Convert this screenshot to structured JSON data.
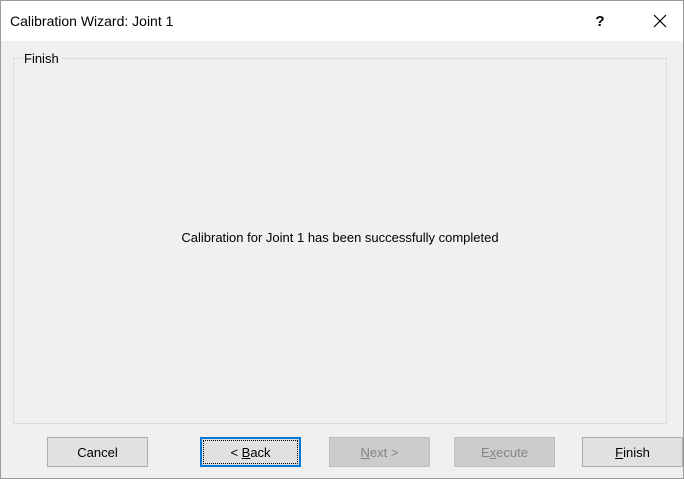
{
  "window": {
    "title": "Calibration Wizard: Joint 1",
    "help_glyph": "?",
    "close_glyph": "close"
  },
  "group": {
    "label": "Finish"
  },
  "message": "Calibration for Joint 1 has been successfully completed",
  "buttons": {
    "cancel": {
      "label": "Cancel",
      "enabled": true
    },
    "back": {
      "prefix": "< ",
      "mnemonic": "B",
      "rest": "ack",
      "enabled": true,
      "default": true
    },
    "next": {
      "mnemonic": "N",
      "rest": "ext >",
      "enabled": false
    },
    "execute": {
      "prefix": "E",
      "mnemonic": "x",
      "rest": "ecute",
      "enabled": false
    },
    "finish": {
      "mnemonic": "F",
      "rest": "inish",
      "enabled": true
    }
  },
  "colors": {
    "accent": "#0078d7",
    "disabled_text": "#838383"
  }
}
